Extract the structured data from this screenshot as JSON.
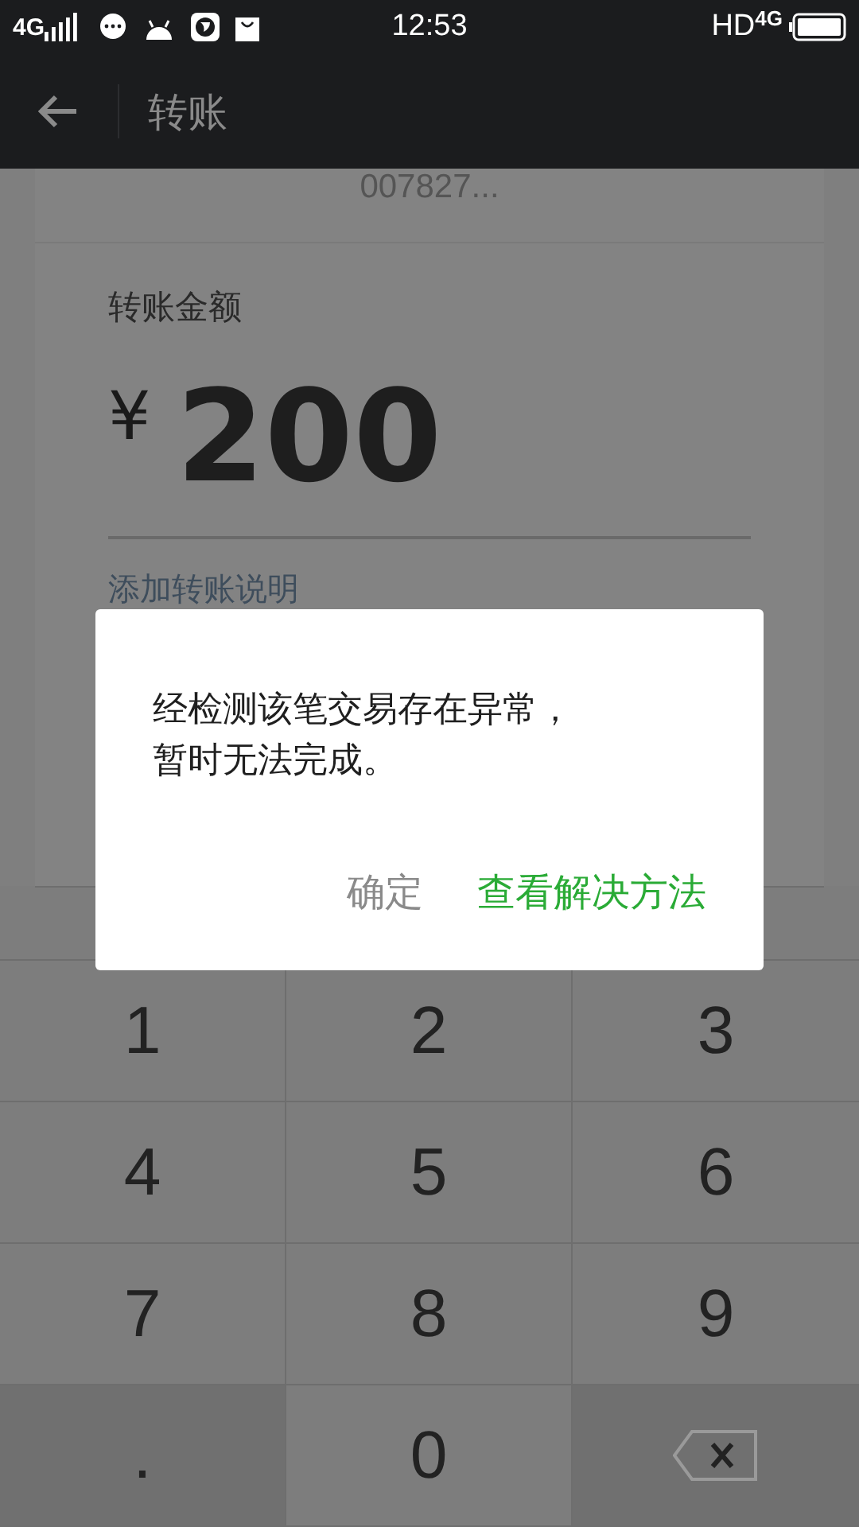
{
  "status_bar": {
    "network": "4G",
    "time": "12:53",
    "hd": "HD",
    "network_right": "4G"
  },
  "app_bar": {
    "title": "转账"
  },
  "payee": {
    "account": "007827..."
  },
  "amount": {
    "label": "转账金额",
    "currency": "¥",
    "value": "200"
  },
  "note_link": "添加转账说明",
  "dialog": {
    "message": [
      "经检测该笔交易存在异常，",
      "暂时无法完成。"
    ],
    "buttons": [
      {
        "label": "确定",
        "kind": "secondary"
      },
      {
        "label": "查看解决方法",
        "kind": "primary"
      }
    ]
  },
  "keypad": [
    {
      "label": "1",
      "kind": "digit"
    },
    {
      "label": "2",
      "kind": "digit"
    },
    {
      "label": "3",
      "kind": "digit"
    },
    {
      "label": "4",
      "kind": "digit"
    },
    {
      "label": "5",
      "kind": "digit"
    },
    {
      "label": "6",
      "kind": "digit"
    },
    {
      "label": "7",
      "kind": "digit"
    },
    {
      "label": "8",
      "kind": "digit"
    },
    {
      "label": "9",
      "kind": "digit"
    },
    {
      "label": ".",
      "kind": "side"
    },
    {
      "label": "0",
      "kind": "digit"
    },
    {
      "kind": "delete"
    }
  ]
}
